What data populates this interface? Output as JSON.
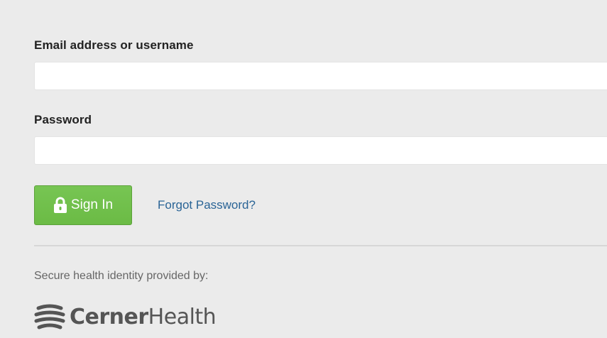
{
  "login_form": {
    "email_label": "Email address or username",
    "email_value": "",
    "password_label": "Password",
    "password_value": "",
    "sign_in_label": "Sign In",
    "sign_in_icon": "lock-icon",
    "forgot_password_label": "Forgot Password?"
  },
  "footer": {
    "secure_text": "Secure health identity provided by:",
    "logo": {
      "icon": "cerner-logo-icon",
      "brand_bold": "Cerner",
      "brand_light": "Health"
    }
  },
  "colors": {
    "background": "#ebebeb",
    "sign_in_button": "#6bbb45",
    "link": "#2a6496",
    "logo": "#555555"
  }
}
